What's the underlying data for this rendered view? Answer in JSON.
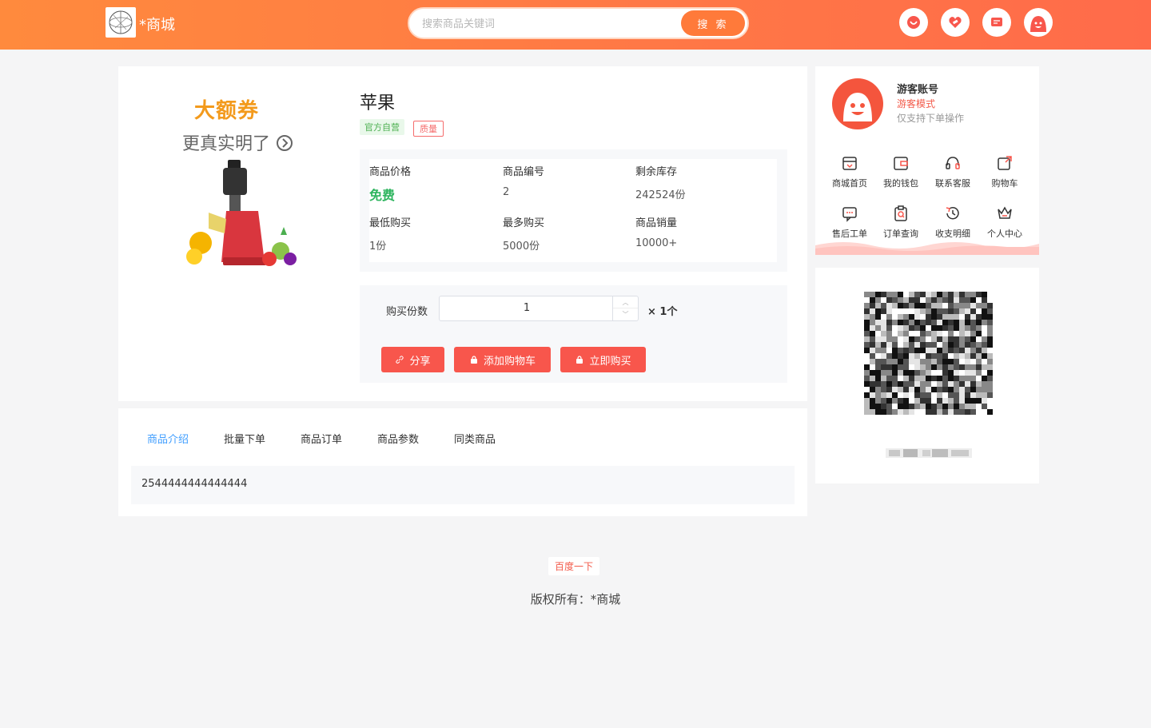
{
  "header": {
    "logo_text": "*商城",
    "search_placeholder": "搜索商品关键词",
    "search_button": "搜 索",
    "icons": [
      "smile-icon",
      "coupon-icon",
      "message-icon",
      "user-avatar-icon"
    ]
  },
  "product": {
    "ad_title": "大额券",
    "ad_subtitle": "更真实明了",
    "name": "苹果",
    "tag_official": "官方自营",
    "tag_quality": "质量",
    "info": {
      "price_label": "商品价格",
      "price_value": "免费",
      "id_label": "商品编号",
      "id_value": "2",
      "stock_label": "剩余库存",
      "stock_value": "242524份",
      "min_label": "最低购买",
      "min_value": "1份",
      "max_label": "最多购买",
      "max_value": "5000份",
      "sales_label": "商品销量",
      "sales_value": "10000+"
    },
    "quantity_label": "购买份数",
    "quantity_value": "1",
    "quantity_unit": "× 1个",
    "buttons": {
      "share": "分享",
      "add_cart": "添加购物车",
      "buy_now": "立即购买"
    }
  },
  "tabs": {
    "items": [
      "商品介绍",
      "批量下单",
      "商品订单",
      "商品参数",
      "同类商品"
    ],
    "active_index": 0,
    "content": "2544444444444444"
  },
  "user": {
    "name": "游客账号",
    "mode": "游客模式",
    "note": "仅支持下单操作",
    "menu": [
      {
        "label": "商城首页",
        "icon": "store-icon"
      },
      {
        "label": "我的钱包",
        "icon": "wallet-icon"
      },
      {
        "label": "联系客服",
        "icon": "headset-icon"
      },
      {
        "label": "购物车",
        "icon": "cart-icon"
      },
      {
        "label": "售后工单",
        "icon": "chat-icon"
      },
      {
        "label": "订单查询",
        "icon": "order-search-icon"
      },
      {
        "label": "收支明细",
        "icon": "history-icon"
      },
      {
        "label": "个人中心",
        "icon": "crown-icon"
      }
    ]
  },
  "footer": {
    "link": "百度一下",
    "copyright": "版权所有：*商城"
  },
  "colors": {
    "header_start": "#ff8a3d",
    "header_end": "#ff6b4a",
    "accent_red": "#f8564c",
    "free_green": "#2fb55f",
    "tab_active": "#409eff"
  }
}
